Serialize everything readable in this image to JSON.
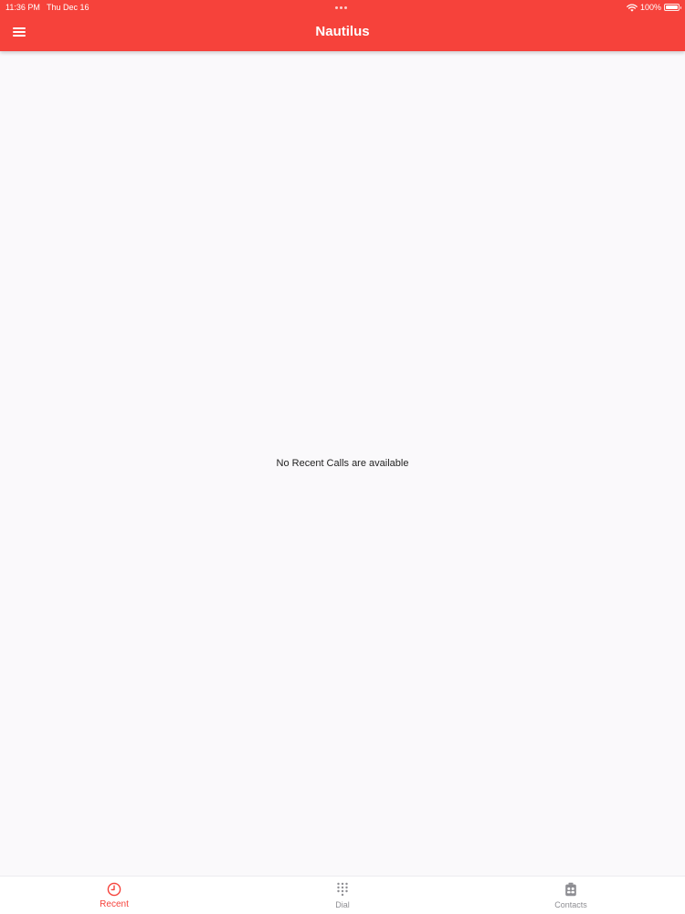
{
  "status_bar": {
    "time": "11:36 PM",
    "date": "Thu Dec 16",
    "battery": "100%"
  },
  "header": {
    "title": "Nautilus",
    "menu_icon": "hamburger-menu-icon"
  },
  "main": {
    "empty_message": "No Recent Calls are available"
  },
  "tabs": [
    {
      "label": "Recent",
      "icon": "clock-icon",
      "active": true
    },
    {
      "label": "Dial",
      "icon": "dialpad-icon",
      "active": false
    },
    {
      "label": "Contacts",
      "icon": "contacts-icon",
      "active": false
    }
  ],
  "colors": {
    "accent": "#f6423b",
    "background": "#faf9fb",
    "inactive_tab": "#8e8e93"
  }
}
